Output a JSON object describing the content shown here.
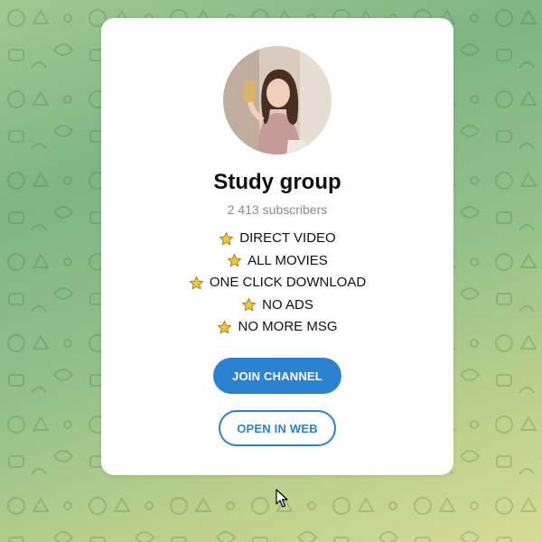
{
  "channel": {
    "title": "Study group",
    "subscribers": "2 413 subscribers",
    "features": [
      {
        "icon": "star-icon",
        "text": "DIRECT VIDEO"
      },
      {
        "icon": "star-icon",
        "text": "ALL MOVIES"
      },
      {
        "icon": "star-icon",
        "text": "ONE CLICK DOWNLOAD"
      },
      {
        "icon": "star-icon",
        "text": "NO ADS"
      },
      {
        "icon": "star-icon",
        "text": "NO MORE MSG"
      }
    ]
  },
  "actions": {
    "join_label": "JOIN CHANNEL",
    "open_web_label": "OPEN IN WEB"
  },
  "colors": {
    "accent": "#2b82d0",
    "card_bg": "#ffffff",
    "title_text": "#111111",
    "muted_text": "#8a8a8a",
    "star_fill": "#f5c542"
  },
  "icons": {
    "avatar": "channel-avatar-photo",
    "feature_bullet": "star-icon",
    "pointer": "mouse-cursor-icon"
  }
}
